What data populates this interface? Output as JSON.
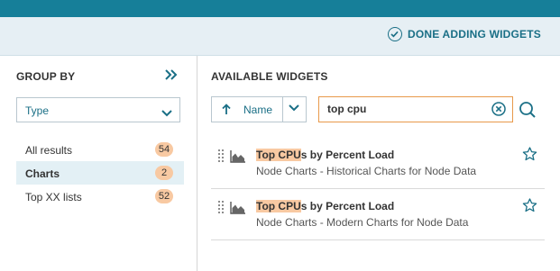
{
  "header": {
    "done_label": "DONE ADDING WIDGETS"
  },
  "left": {
    "title": "GROUP BY",
    "select": {
      "value": "Type"
    },
    "groups": [
      {
        "label": "All results",
        "count": "54"
      },
      {
        "label": "Charts",
        "count": "2"
      },
      {
        "label": "Top XX lists",
        "count": "52"
      }
    ]
  },
  "right": {
    "title": "AVAILABLE WIDGETS",
    "sort": {
      "label": "Name"
    },
    "search": {
      "value": "top cpu"
    },
    "widgets": [
      {
        "title_highlight": "Top CPU",
        "title_rest": "s by Percent Load",
        "subtitle": "Node Charts - Historical Charts for Node Data"
      },
      {
        "title_highlight": "Top CPU",
        "title_rest": "s by Percent Load",
        "subtitle": "Node Charts - Modern Charts for Node Data"
      }
    ]
  },
  "icons": {
    "done": "check-circle-icon",
    "collapse": "double-chevron-right-icon",
    "select": "chevron-down-icon",
    "sort": "arrow-up-icon",
    "clear": "clear-x-circle-icon",
    "search": "search-icon",
    "drag": "drag-handle-icon",
    "chart": "area-chart-icon",
    "favorite": "star-outline-icon"
  },
  "colors": {
    "topbar": "#167f99",
    "accent": "#1a6f86",
    "highlight": "#f8c9a2",
    "search_border": "#e8994a",
    "active_row": "#e3f0f5"
  }
}
